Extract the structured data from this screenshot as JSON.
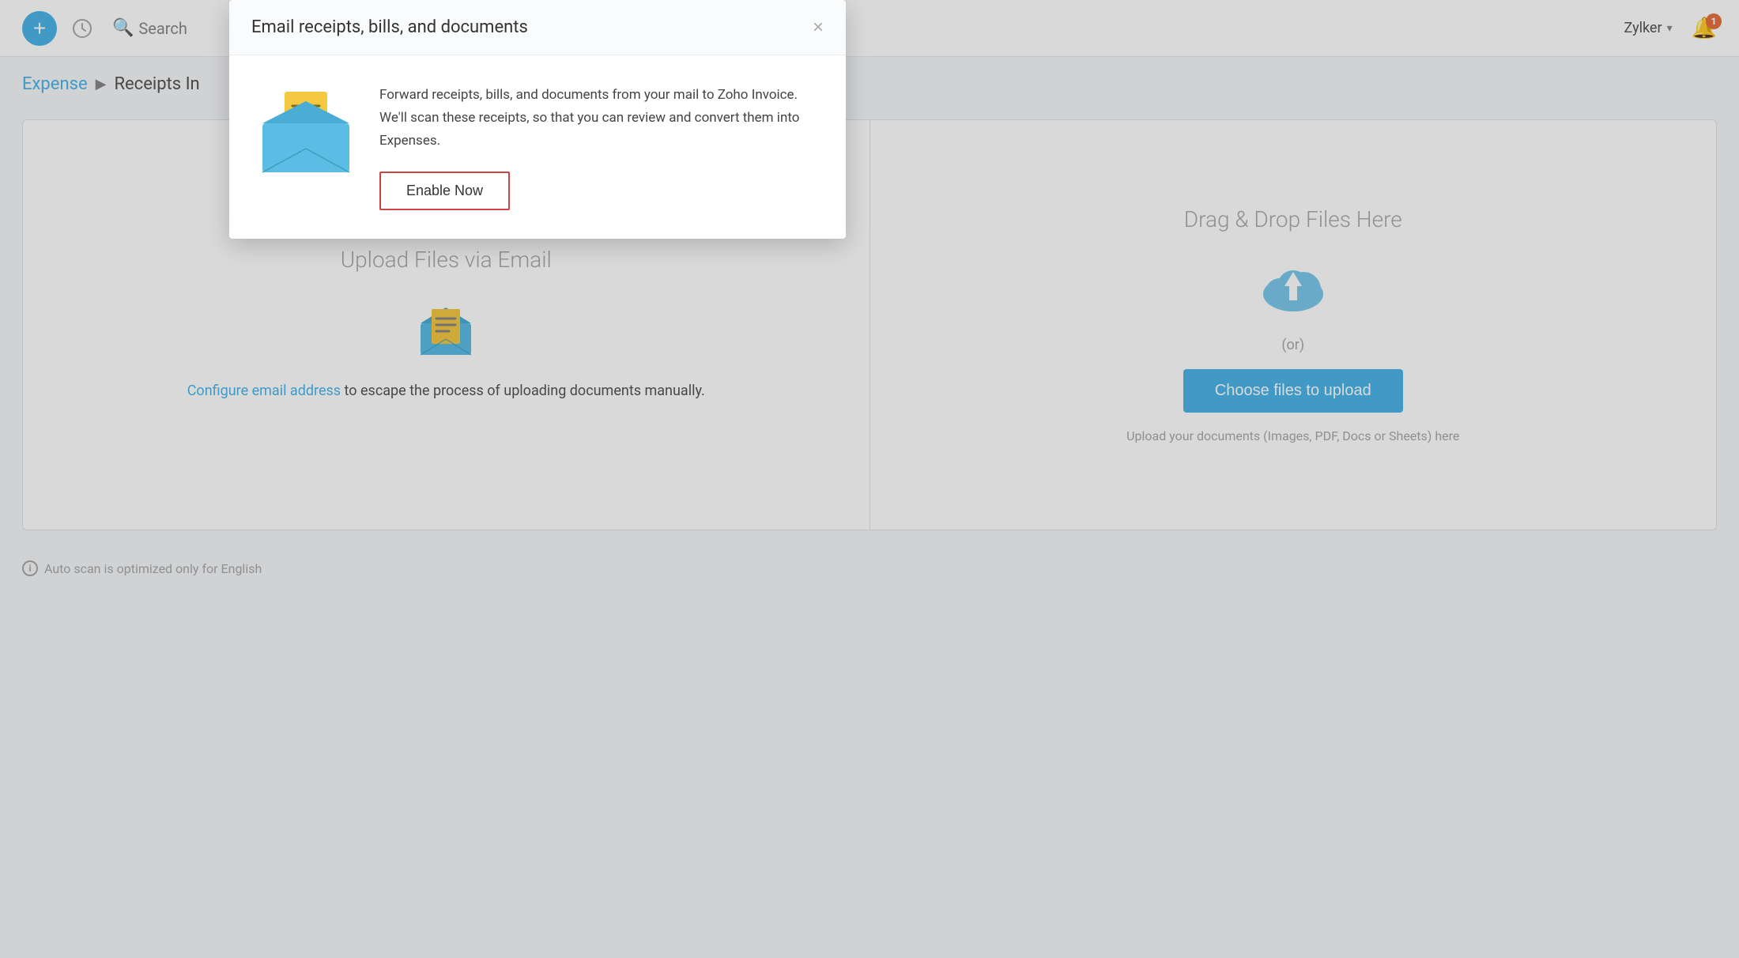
{
  "navbar": {
    "add_label": "+",
    "search_label": "Search",
    "org_name": "Zylker",
    "bell_badge": "1"
  },
  "breadcrumb": {
    "parent": "Expense",
    "separator": "▶",
    "current": "Receipts In"
  },
  "upload_email_section": {
    "title": "Upload Files via Email",
    "configure_link": "Configure email address",
    "configure_text": " to escape the process of uploading documents manually."
  },
  "drag_drop_section": {
    "title": "Drag & Drop Files Here",
    "or_text": "(or)",
    "choose_btn": "Choose files to upload",
    "hint": "Upload your documents (Images, PDF, Docs or Sheets) here"
  },
  "auto_scan": {
    "text": "Auto scan is optimized only for English"
  },
  "modal": {
    "title": "Email receipts, bills, and documents",
    "close_label": "×",
    "description": "Forward receipts, bills, and documents from your mail to Zoho Invoice. We'll scan these receipts, so that you can review and convert them into Expenses.",
    "enable_btn": "Enable Now"
  }
}
